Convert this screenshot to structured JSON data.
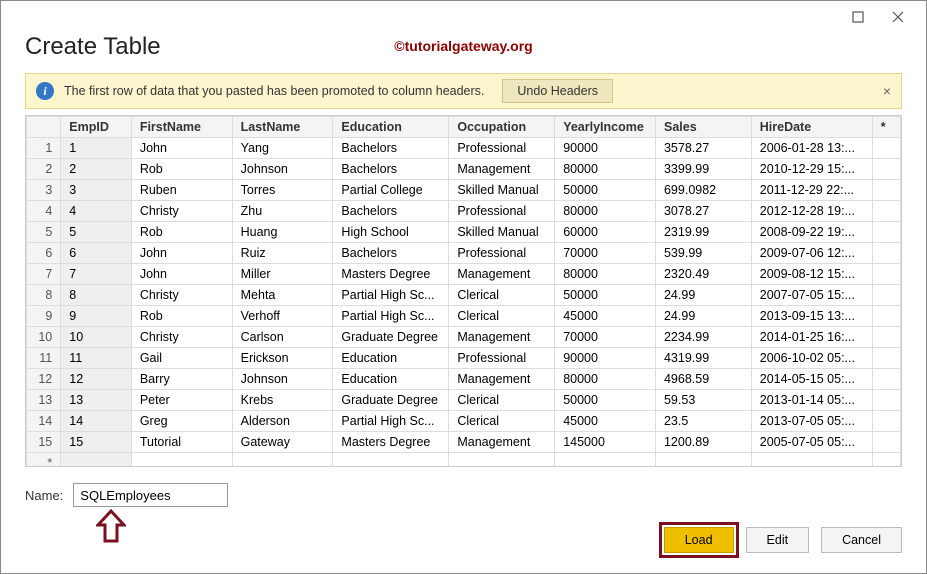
{
  "dialog": {
    "title": "Create Table",
    "watermark": "©tutorialgateway.org"
  },
  "banner": {
    "message": "The first row of data that you pasted has been promoted to column headers.",
    "undo_label": "Undo Headers",
    "close_label": "×"
  },
  "columns": [
    "EmpID",
    "FirstName",
    "LastName",
    "Education",
    "Occupation",
    "YearlyIncome",
    "Sales",
    "HireDate"
  ],
  "star_col": "*",
  "rows": [
    {
      "n": 1,
      "EmpID": "1",
      "FirstName": "John",
      "LastName": "Yang",
      "Education": "Bachelors",
      "Occupation": "Professional",
      "YearlyIncome": "90000",
      "Sales": "3578.27",
      "HireDate": "2006-01-28 13:..."
    },
    {
      "n": 2,
      "EmpID": "2",
      "FirstName": "Rob",
      "LastName": "Johnson",
      "Education": "Bachelors",
      "Occupation": "Management",
      "YearlyIncome": "80000",
      "Sales": "3399.99",
      "HireDate": "2010-12-29 15:..."
    },
    {
      "n": 3,
      "EmpID": "3",
      "FirstName": "Ruben",
      "LastName": "Torres",
      "Education": "Partial College",
      "Occupation": "Skilled Manual",
      "YearlyIncome": "50000",
      "Sales": "699.0982",
      "HireDate": "2011-12-29 22:..."
    },
    {
      "n": 4,
      "EmpID": "4",
      "FirstName": "Christy",
      "LastName": "Zhu",
      "Education": "Bachelors",
      "Occupation": "Professional",
      "YearlyIncome": "80000",
      "Sales": "3078.27",
      "HireDate": "2012-12-28 19:..."
    },
    {
      "n": 5,
      "EmpID": "5",
      "FirstName": "Rob",
      "LastName": "Huang",
      "Education": "High School",
      "Occupation": "Skilled Manual",
      "YearlyIncome": "60000",
      "Sales": "2319.99",
      "HireDate": "2008-09-22 19:..."
    },
    {
      "n": 6,
      "EmpID": "6",
      "FirstName": "John",
      "LastName": "Ruiz",
      "Education": "Bachelors",
      "Occupation": "Professional",
      "YearlyIncome": "70000",
      "Sales": "539.99",
      "HireDate": "2009-07-06 12:..."
    },
    {
      "n": 7,
      "EmpID": "7",
      "FirstName": "John",
      "LastName": "Miller",
      "Education": "Masters Degree",
      "Occupation": "Management",
      "YearlyIncome": "80000",
      "Sales": "2320.49",
      "HireDate": "2009-08-12 15:..."
    },
    {
      "n": 8,
      "EmpID": "8",
      "FirstName": "Christy",
      "LastName": "Mehta",
      "Education": "Partial High Sc...",
      "Occupation": "Clerical",
      "YearlyIncome": "50000",
      "Sales": "24.99",
      "HireDate": "2007-07-05 15:..."
    },
    {
      "n": 9,
      "EmpID": "9",
      "FirstName": "Rob",
      "LastName": "Verhoff",
      "Education": "Partial High Sc...",
      "Occupation": "Clerical",
      "YearlyIncome": "45000",
      "Sales": "24.99",
      "HireDate": "2013-09-15 13:..."
    },
    {
      "n": 10,
      "EmpID": "10",
      "FirstName": "Christy",
      "LastName": "Carlson",
      "Education": "Graduate Degree",
      "Occupation": "Management",
      "YearlyIncome": "70000",
      "Sales": "2234.99",
      "HireDate": "2014-01-25 16:..."
    },
    {
      "n": 11,
      "EmpID": "11",
      "FirstName": "Gail",
      "LastName": "Erickson",
      "Education": "Education",
      "Occupation": "Professional",
      "YearlyIncome": "90000",
      "Sales": "4319.99",
      "HireDate": "2006-10-02 05:..."
    },
    {
      "n": 12,
      "EmpID": "12",
      "FirstName": "Barry",
      "LastName": "Johnson",
      "Education": "Education",
      "Occupation": "Management",
      "YearlyIncome": "80000",
      "Sales": "4968.59",
      "HireDate": "2014-05-15 05:..."
    },
    {
      "n": 13,
      "EmpID": "13",
      "FirstName": "Peter",
      "LastName": "Krebs",
      "Education": "Graduate Degree",
      "Occupation": "Clerical",
      "YearlyIncome": "50000",
      "Sales": "59.53",
      "HireDate": "2013-01-14 05:..."
    },
    {
      "n": 14,
      "EmpID": "14",
      "FirstName": "Greg",
      "LastName": "Alderson",
      "Education": "Partial High Sc...",
      "Occupation": "Clerical",
      "YearlyIncome": "45000",
      "Sales": "23.5",
      "HireDate": "2013-07-05 05:..."
    },
    {
      "n": 15,
      "EmpID": "15",
      "FirstName": "Tutorial",
      "LastName": "Gateway",
      "Education": "Masters Degree",
      "Occupation": "Management",
      "YearlyIncome": "145000",
      "Sales": "1200.89",
      "HireDate": "2005-07-05 05:..."
    }
  ],
  "blank_row_marker": "*",
  "name": {
    "label": "Name:",
    "value": "SQLEmployees"
  },
  "buttons": {
    "load": "Load",
    "edit": "Edit",
    "cancel": "Cancel"
  }
}
